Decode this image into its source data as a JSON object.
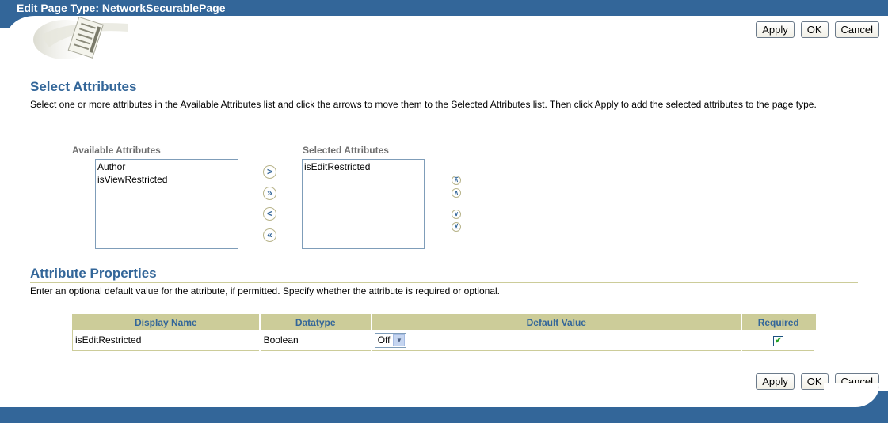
{
  "header": {
    "title": "Edit Page Type: NetworkSecurablePage",
    "brand_color": "#336699"
  },
  "actions": {
    "apply_label": "Apply",
    "ok_label": "OK",
    "cancel_label": "Cancel"
  },
  "select_attributes": {
    "heading": "Select Attributes",
    "description": "Select one or more attributes in the Available Attributes list and click the arrows to move them to the Selected Attributes list. Then click Apply to add the selected attributes to the page type.",
    "available_label": "Available Attributes",
    "available_items": [
      "Author",
      "isViewRestricted"
    ],
    "selected_label": "Selected Attributes",
    "selected_items": [
      "isEditRestricted"
    ],
    "shuttle_icons": {
      "move": "chevron-right-icon",
      "move_all": "double-chevron-right-icon",
      "remove": "chevron-left-icon",
      "remove_all": "double-chevron-left-icon"
    },
    "reorder_icons": {
      "top": "move-to-top-icon",
      "up": "move-up-icon",
      "down": "move-down-icon",
      "bottom": "move-to-bottom-icon"
    }
  },
  "attribute_properties": {
    "heading": "Attribute Properties",
    "description": "Enter an optional default value for the attribute, if permitted. Specify whether the attribute is required or optional.",
    "columns": [
      "Display Name",
      "Datatype",
      "Default Value",
      "Required"
    ],
    "rows": [
      {
        "display_name": "isEditRestricted",
        "datatype": "Boolean",
        "default_value": "Off",
        "required": true
      }
    ]
  }
}
